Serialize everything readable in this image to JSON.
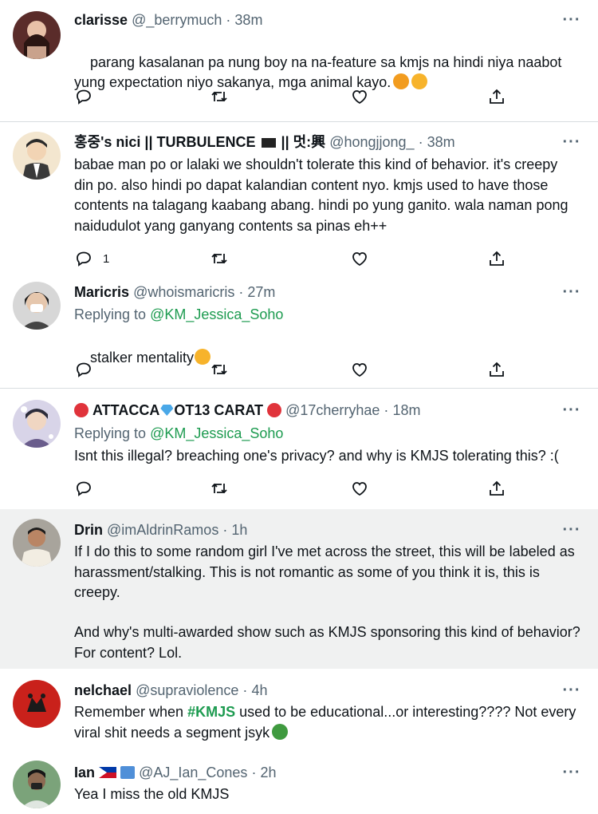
{
  "tweets": [
    {
      "name": "clarisse",
      "handle": "@_berrymuch",
      "time": "38m",
      "body": "parang kasalanan pa nung boy na na-feature sa kmjs na hindi niya naabot yung expectation niyo sakanya, mga animal kayo.",
      "reply_count": ""
    },
    {
      "name": "홍중's nici || TURBULENCE",
      "name_suffix": "|| 멋:興",
      "handle": "@hongjjong_",
      "time": "38m",
      "body": "babae man po or lalaki we shouldn't tolerate this kind of behavior. it's creepy din po. also hindi po dapat kalandian content nyo. kmjs used to have those contents na talagang kaabang abang. hindi po yung ganito. wala naman pong naidudulot yang ganyang contents sa pinas eh++",
      "reply_count": "1"
    },
    {
      "name": "Maricris",
      "handle": "@whoismaricris",
      "time": "27m",
      "replying_to_label": "Replying to",
      "replying_to": "@KM_Jessica_Soho",
      "body": "stalker mentality",
      "reply_count": ""
    },
    {
      "name": "ATTACCA",
      "name_mid": "OT13 CARAT",
      "handle": "@17cherryhae",
      "time": "18m",
      "replying_to_label": "Replying to",
      "replying_to": "@KM_Jessica_Soho",
      "body": "Isnt this illegal? breaching one's privacy? and why is KMJS tolerating this? :(",
      "reply_count": ""
    },
    {
      "name": "Drin",
      "handle": "@imAldrinRamos",
      "time": "1h",
      "body_p1": "If I do this to some random girl I've met across the street, this will be labeled as harassment/stalking. This is not romantic as some of you think it is, this is creepy.",
      "body_p2": "And why's multi-awarded show such as KMJS sponsoring this kind of behavior? For content? Lol."
    },
    {
      "name": "nelchael",
      "handle": "@supraviolence",
      "time": "4h",
      "body_hashtag": "#KMJS",
      "body_before": "Remember when ",
      "body_after": " used to be educational...or interesting???? Not every viral shit needs a segment jsyk"
    },
    {
      "name": "Ian",
      "handle": "@AJ_Ian_Cones",
      "time": "2h",
      "body": "Yea I miss the old KMJS"
    }
  ],
  "ui": {
    "more_label": "···",
    "separator": "·"
  },
  "icons": {
    "reply": "reply-icon",
    "retweet": "retweet-icon",
    "like": "like-icon",
    "share": "share-icon"
  },
  "colors": {
    "accent_green": "#1d9b50",
    "muted": "#536471",
    "highlight_bg": "#f0f1f1"
  }
}
